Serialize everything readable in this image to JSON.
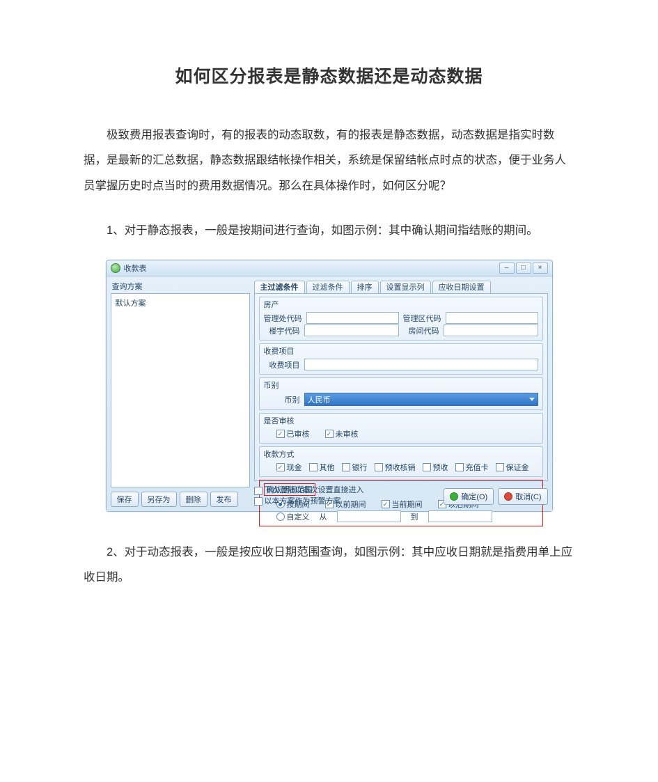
{
  "title": "如何区分报表是静态数据还是动态数据",
  "paragraphs": {
    "intro": "极致费用报表查询时，有的报表的动态取数，有的报表是静态数据，动态数据是指实时数据，是最新的汇总数据，静态数据跟结帐操作相关，系统是保留结帐点时点的状态，便于业务人员掌握历史时点当时的费用数据情况。那么在具体操作时，如何区分呢？",
    "item1": "1、对于静态报表，一般是按期间进行查询，如图示例：其中确认期间指结账的期间。",
    "item2": "2、对于动态报表，一般是按应收日期范围查询，如图示例：其中应收日期就是指费用单上应收日期。"
  },
  "shot": {
    "windowTitle": "收款表",
    "leftPanelTitle": "查询方案",
    "defaultPlan": "默认方案",
    "leftButtons": {
      "save": "保存",
      "saveAs": "另存为",
      "delete": "删除",
      "publish": "发布"
    },
    "tabs": [
      "主过滤条件",
      "过滤条件",
      "排序",
      "设置显示列",
      "应收日期设置"
    ],
    "groups": {
      "property": {
        "title": "房产",
        "fields": {
          "mgmtOffice": "管理处代码",
          "mgmtArea": "管理区代码",
          "building": "楼宇代码",
          "room": "房间代码"
        }
      },
      "feeItem": {
        "title": "收费项目",
        "field": "收费项目"
      },
      "currency": {
        "title": "币别",
        "field": "币别",
        "value": "人民币"
      },
      "audit": {
        "title": "是否审核",
        "audited": "已审核",
        "unaudited": "未审核"
      },
      "payMethod": {
        "title": "收款方式",
        "options": [
          "现金",
          "其他",
          "银行",
          "预收核销",
          "预收",
          "充值卡",
          "保证金"
        ]
      },
      "confirmRange": {
        "tag": "确认期间范围",
        "byPeriod": "按期间",
        "beforePeriod": "以前期间",
        "currentPeriod": "当前期间",
        "afterPeriod": "以后期间",
        "custom": "自定义",
        "from": "从",
        "to": "到"
      }
    },
    "footer": {
      "check1": "下次登陆以本次设置直接进入",
      "check2": "以本方案作为预警方案",
      "ok": "确定(O)",
      "cancel": "取消(C)"
    }
  }
}
